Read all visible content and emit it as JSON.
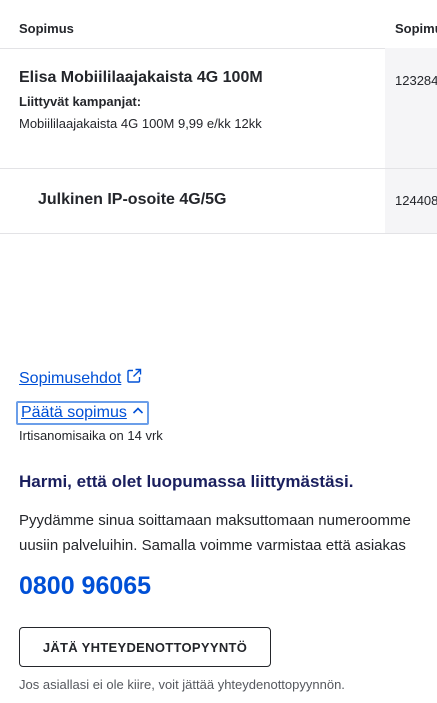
{
  "table": {
    "headers": [
      "Sopimus",
      "Sopimu"
    ],
    "rows": [
      {
        "name": "Elisa Mobiililaajakaista 4G 100M",
        "campaigns_label": "Liittyvät kampanjat:",
        "campaigns": [
          "Mobiililaajakaista 4G 100M 9,99 e/kk 12kk"
        ],
        "number": "123284"
      },
      {
        "name": "Julkinen IP-osoite 4G/5G",
        "number": "124408"
      }
    ]
  },
  "links": {
    "terms": "Sopimusehdot",
    "end_contract": "Päätä sopimus",
    "notice_period": "Irtisanomisaika on 14 vrk"
  },
  "retention": {
    "heading": "Harmi, että olet luopumassa liittymästäsi.",
    "line1": "Pyydämme sinua soittamaan maksuttomaan numeroomme",
    "line2": "uusiin palveluihin. Samalla voimme varmistaa että asiakas",
    "phone": "0800 96065",
    "button": "JÄTÄ YHTEYDENOTTOPYYNTÖ",
    "hint": "Jos asiallasi ei ole kiire, voit jättää yhteydenottopyynnön."
  },
  "icons": {
    "external": "external-link-icon",
    "chevron": "chevron-up-icon"
  },
  "colors": {
    "link": "#0050d6",
    "heading": "#1a1f5e",
    "focus": "#6b9ee9"
  }
}
